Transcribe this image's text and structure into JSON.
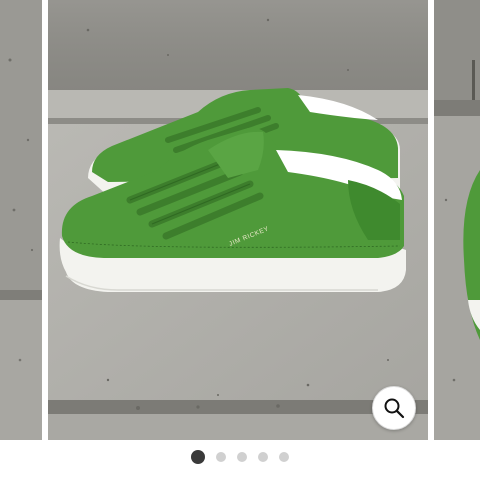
{
  "carousel": {
    "images": [
      {
        "icon": "previous-slide-image"
      },
      {
        "icon": "sneaker-product-image",
        "brand_text": "JIM RICKEY"
      },
      {
        "icon": "next-slide-image"
      }
    ],
    "zoom_icon": "search-icon",
    "current_index": 1,
    "total": 5,
    "dots": [
      1,
      2,
      3,
      4,
      5
    ]
  },
  "colors": {
    "sneaker": "#4f9a3a",
    "sneaker_dark": "#3d7e2c",
    "sole": "#f3f3ef",
    "concrete": "#9d9c97",
    "step_top": "#b7b6b1",
    "dot_active": "#3a3a3a",
    "dot_inactive": "#d0d0d0"
  }
}
